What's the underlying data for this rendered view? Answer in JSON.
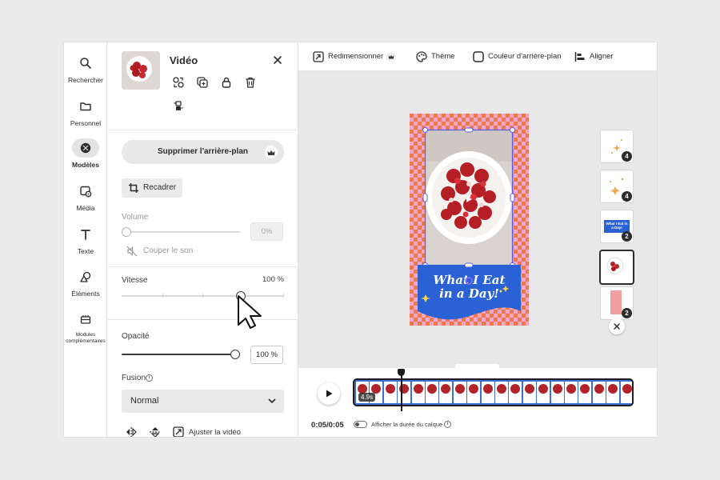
{
  "rail": {
    "items": [
      {
        "id": "search",
        "label": "Rechercher",
        "icon": "search-icon"
      },
      {
        "id": "personal",
        "label": "Personnel",
        "icon": "folder-icon"
      },
      {
        "id": "templates",
        "label": "Modèles",
        "icon": "templates-icon",
        "active": true
      },
      {
        "id": "media",
        "label": "Média",
        "icon": "media-icon"
      },
      {
        "id": "text",
        "label": "Texte",
        "icon": "text-icon"
      },
      {
        "id": "elements",
        "label": "Éléments",
        "icon": "shapes-icon"
      },
      {
        "id": "addons",
        "label": "Modules complémentaires",
        "icon": "addons-icon"
      }
    ]
  },
  "panel": {
    "title": "Vidéo",
    "remove_bg_label": "Supprimer l'arrière-plan",
    "crop_label": "Recadrer",
    "volume": {
      "label": "Volume",
      "value": "0%",
      "mute_label": "Couper le son"
    },
    "speed": {
      "label": "Vitesse",
      "value_text": "100 %",
      "level": 0.83
    },
    "opacity": {
      "label": "Opacité",
      "value": "100 %",
      "level": 1.0
    },
    "blend": {
      "label": "Fusion",
      "selected": "Normal"
    },
    "fit_label": "Ajuster la vidéo"
  },
  "toolbar": {
    "resize": "Redimensionner",
    "theme": "Thème",
    "bg_color": "Couleur d'arrière-plan",
    "align": "Aligner"
  },
  "canvas": {
    "headline": "What I Eat in a Day!",
    "headline_line1": "What I Eat",
    "headline_line2": "in a Day!",
    "thumb_caption": "What I Eat in a Day!",
    "pages": [
      {
        "badge": "4"
      },
      {
        "badge": "4"
      },
      {
        "badge": "2"
      },
      {
        "badge": "",
        "active": true
      },
      {
        "badge": "2"
      }
    ]
  },
  "timeline": {
    "duration_chip": "4.9s",
    "timecode": "0:05/0:05",
    "layer_duration_label": "Afficher la durée du calque"
  },
  "colors": {
    "accent": "#3d6fd6",
    "checker_pink": "#f2a6c9",
    "checker_orange": "#ea7a4e",
    "banner_blue": "#2a62d6"
  }
}
